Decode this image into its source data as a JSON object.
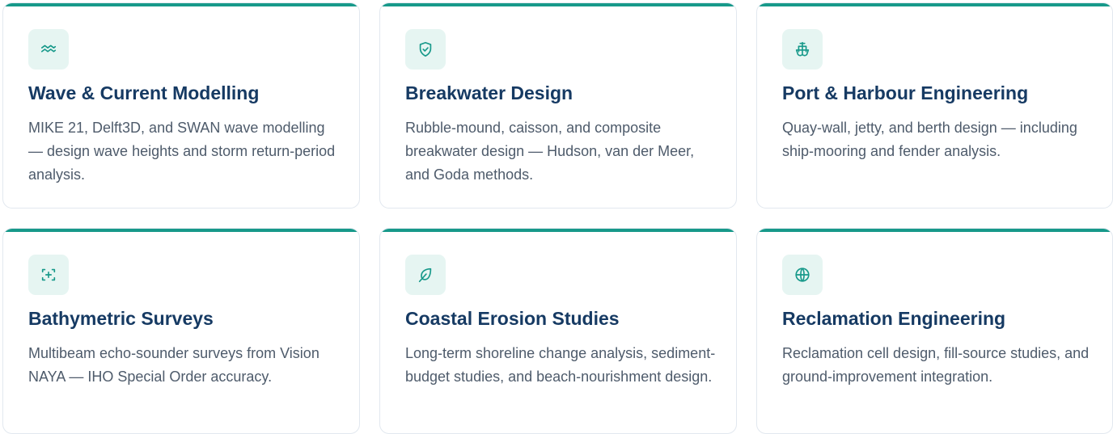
{
  "services": [
    {
      "icon": "waves-icon",
      "title": "Wave & Current Modelling",
      "description": "MIKE 21, Delft3D, and SWAN wave modelling — design wave heights and storm return-period analysis."
    },
    {
      "icon": "shield-check-icon",
      "title": "Breakwater Design",
      "description": "Rubble-mound, caisson, and composite breakwater design — Hudson, van der Meer, and Goda methods."
    },
    {
      "icon": "ship-icon",
      "title": "Port & Harbour Engineering",
      "description": "Quay-wall, jetty, and berth design — including ship-mooring and fender analysis."
    },
    {
      "icon": "scan-plus-icon",
      "title": "Bathymetric Surveys",
      "description": "Multibeam echo-sounder surveys from Vision NAYA — IHO Special Order accuracy."
    },
    {
      "icon": "leaf-icon",
      "title": "Coastal Erosion Studies",
      "description": "Long-term shoreline change analysis, sediment-budget studies, and beach-nourishment design."
    },
    {
      "icon": "globe-icon",
      "title": "Reclamation Engineering",
      "description": "Reclamation cell design, fill-source studies, and ground-improvement integration."
    }
  ],
  "colors": {
    "accent": "#17998a",
    "icon_background": "#e6f5f2",
    "title": "#163a63",
    "body_text": "#4e5b6b",
    "border": "#e2e8ef"
  }
}
